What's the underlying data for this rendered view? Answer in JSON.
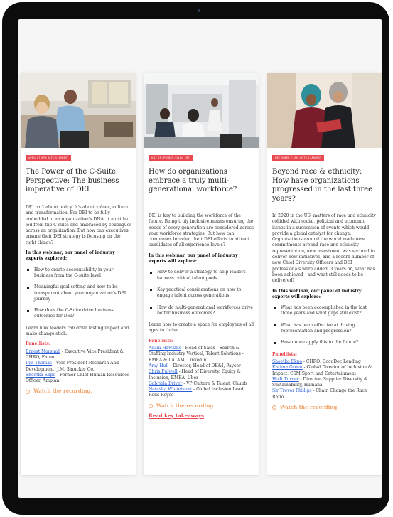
{
  "cards": [
    {
      "badge": "APRIL 27 4PM BST / 11AM EST",
      "title": "The Power of the C-Suite Perspective: The business imperative of DEI",
      "intro": "DEI isn't about policy. It's about values, culture and transformation. For DEI to be fully embedded in an organization's DNA, it must be led from the C-suite and embraced by colleagues across an organization. But how can executives ensure their DEI strategy is focusing on the right things?",
      "lead": "In this webinar, our panel of industry experts explored:",
      "bullets": [
        "How to create accountability in your business from the C-suite level",
        "Meaningful goal-setting and how to be transparent about your organization's DEI journey",
        "How does the C-Suite drive business outcomes for DEI?"
      ],
      "outro": "Learn how leaders can drive lasting impact and make change stick.",
      "panellists_label": "Panellists:",
      "panellists": [
        {
          "name": "Ernest Marshall",
          "role": " - Executive Vice President & CHRO, Eaton"
        },
        {
          "name": "Ilya Thomas",
          "role": " - Vice President Research And Development, J.M. Smucker Co."
        },
        {
          "name": "Sheetka Ekpo",
          "role": " - Former Chief Human Resources Officer, Amplan"
        }
      ],
      "watch": "Watch the recording."
    },
    {
      "badge": "JULY 13 4PM BST / 11AM EST",
      "title": "How do organizations embrace a truly multi-generational workforce?",
      "intro": "DEI is key to building the workforce of the future. Being truly inclusive means ensuring the needs of every generation are considered across your workforce strategies. But how can companies broaden their DEI efforts to attract candidates of all experience levels?",
      "lead": "In this webinar, our panel of industry experts will explore:",
      "bullets": [
        "How to deliver a strategy to help leaders harness critical talent pools",
        "Key practical considerations on how to engage talent across generations",
        "How do multi-generational workforces drive better business outcomes?"
      ],
      "outro": "Learn how to create a space for employees of all ages to thrive.",
      "panellists_label": "Panellists:",
      "panellists": [
        {
          "name": "Adam Hawkins",
          "role": " - Head of Sales - Search & Staffing Industry Vertical, Talent Solutions - EMEA & LATAM, LinkedIn"
        },
        {
          "name": "Amy Hull",
          "role": " - Director, Head of DE&I, Paycor"
        },
        {
          "name": "Chris Fulwell",
          "role": " - Head of Diversity, Equity & Inclusion, EMEA, Uber"
        },
        {
          "name": "Gabriela Driver",
          "role": " - VP Culture & Talent, Chubb"
        },
        {
          "name": "Natasha Whitehurst",
          "role": " - Global Inclusion Lead, Rolls Royce"
        }
      ],
      "watch": "Watch the recording.",
      "takeaways": "Read key takeaways"
    },
    {
      "badge": "DECEMBER 7 4PM GMT / 11AM EST",
      "title": "Beyond race & ethnicity: How have organizations progressed in the last three years?",
      "intro": "In 2020 in the US, matters of race and ethnicity collided with social, political and economic issues in a succession of events which would provide a global catalyst for change. Organizations around the world made new commitments around race and ethnicity representation, new investment was secured to deliver new initiatives, and a record number of new Chief Diversity Officers and DEI professionals were added. 3 years on, what has been achieved - and what still needs to be delivered?",
      "lead": "In this webinar, our panel of industry experts will explore:",
      "bullets": [
        "What has been accomplished in the last three years and what gaps still exist?",
        "What has been effective at driving representation and progression?",
        "How do we apply this to the future?"
      ],
      "panellists_label": "Panellists:",
      "panellists": [
        {
          "name": "Sheetka Ekpo",
          "role": " - CHRO, DocuDoc Lending"
        },
        {
          "name": "Karima Green",
          "role": " - Global Director of Inclusion & Impact, CSM Sport and Entertainment"
        },
        {
          "name": "Holli Turner",
          "role": " - Director, Supplier Diversity & Sustainability, Humana"
        },
        {
          "name": "Sir Trevor Phillips",
          "role": " - Chair, Change the Race Ratio"
        }
      ],
      "watch": "Watch the recording."
    }
  ],
  "colors": {
    "accent": "#e8474f",
    "watch": "#f0a46c",
    "link": "#2a5bd7"
  }
}
